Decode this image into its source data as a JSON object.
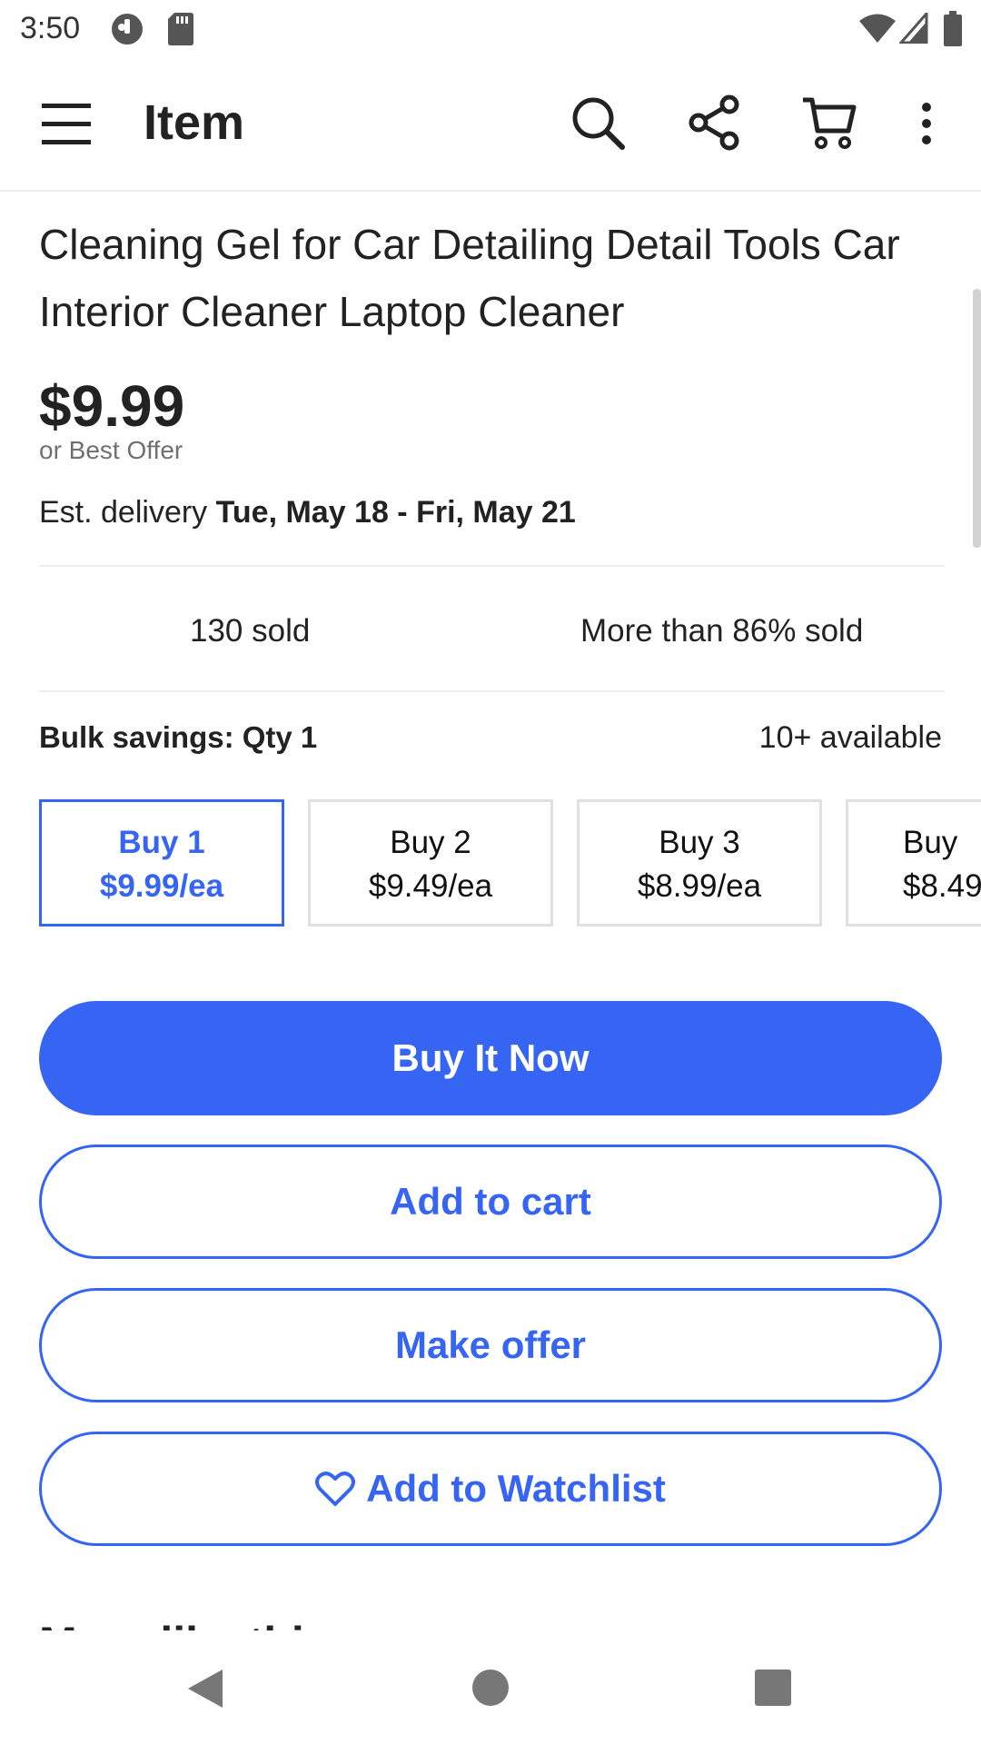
{
  "status_bar": {
    "time": "3:50"
  },
  "app_bar": {
    "title": "Item"
  },
  "item": {
    "title": "Cleaning Gel for Car Detailing Detail Tools Car Interior Cleaner Laptop Cleaner",
    "price": "$9.99",
    "offer_note": "or Best Offer",
    "delivery_label": "Est. delivery",
    "delivery_dates": "Tue, May 18 - Fri, May 21"
  },
  "stats": {
    "sold": "130 sold",
    "sold_percent": "More than 86% sold"
  },
  "bulk": {
    "label": "Bulk savings: Qty 1",
    "available": "10+ available",
    "tiers": [
      {
        "qty": "Buy 1",
        "price": "$9.99/ea"
      },
      {
        "qty": "Buy 2",
        "price": "$9.49/ea"
      },
      {
        "qty": "Buy 3",
        "price": "$8.99/ea"
      },
      {
        "qty": "Buy",
        "price": "$8.49"
      }
    ]
  },
  "actions": {
    "buy_now": "Buy It Now",
    "add_to_cart": "Add to cart",
    "make_offer": "Make offer",
    "watchlist": "Add to Watchlist"
  },
  "section": {
    "more_like_this": "More like this"
  },
  "colors": {
    "accent": "#3665f3",
    "text": "#222222",
    "muted": "#707070"
  },
  "icons": [
    "menu-icon",
    "search-icon",
    "share-icon",
    "cart-icon",
    "more-vert-icon",
    "heart-icon",
    "back-nav-icon",
    "home-nav-icon",
    "recents-nav-icon"
  ]
}
